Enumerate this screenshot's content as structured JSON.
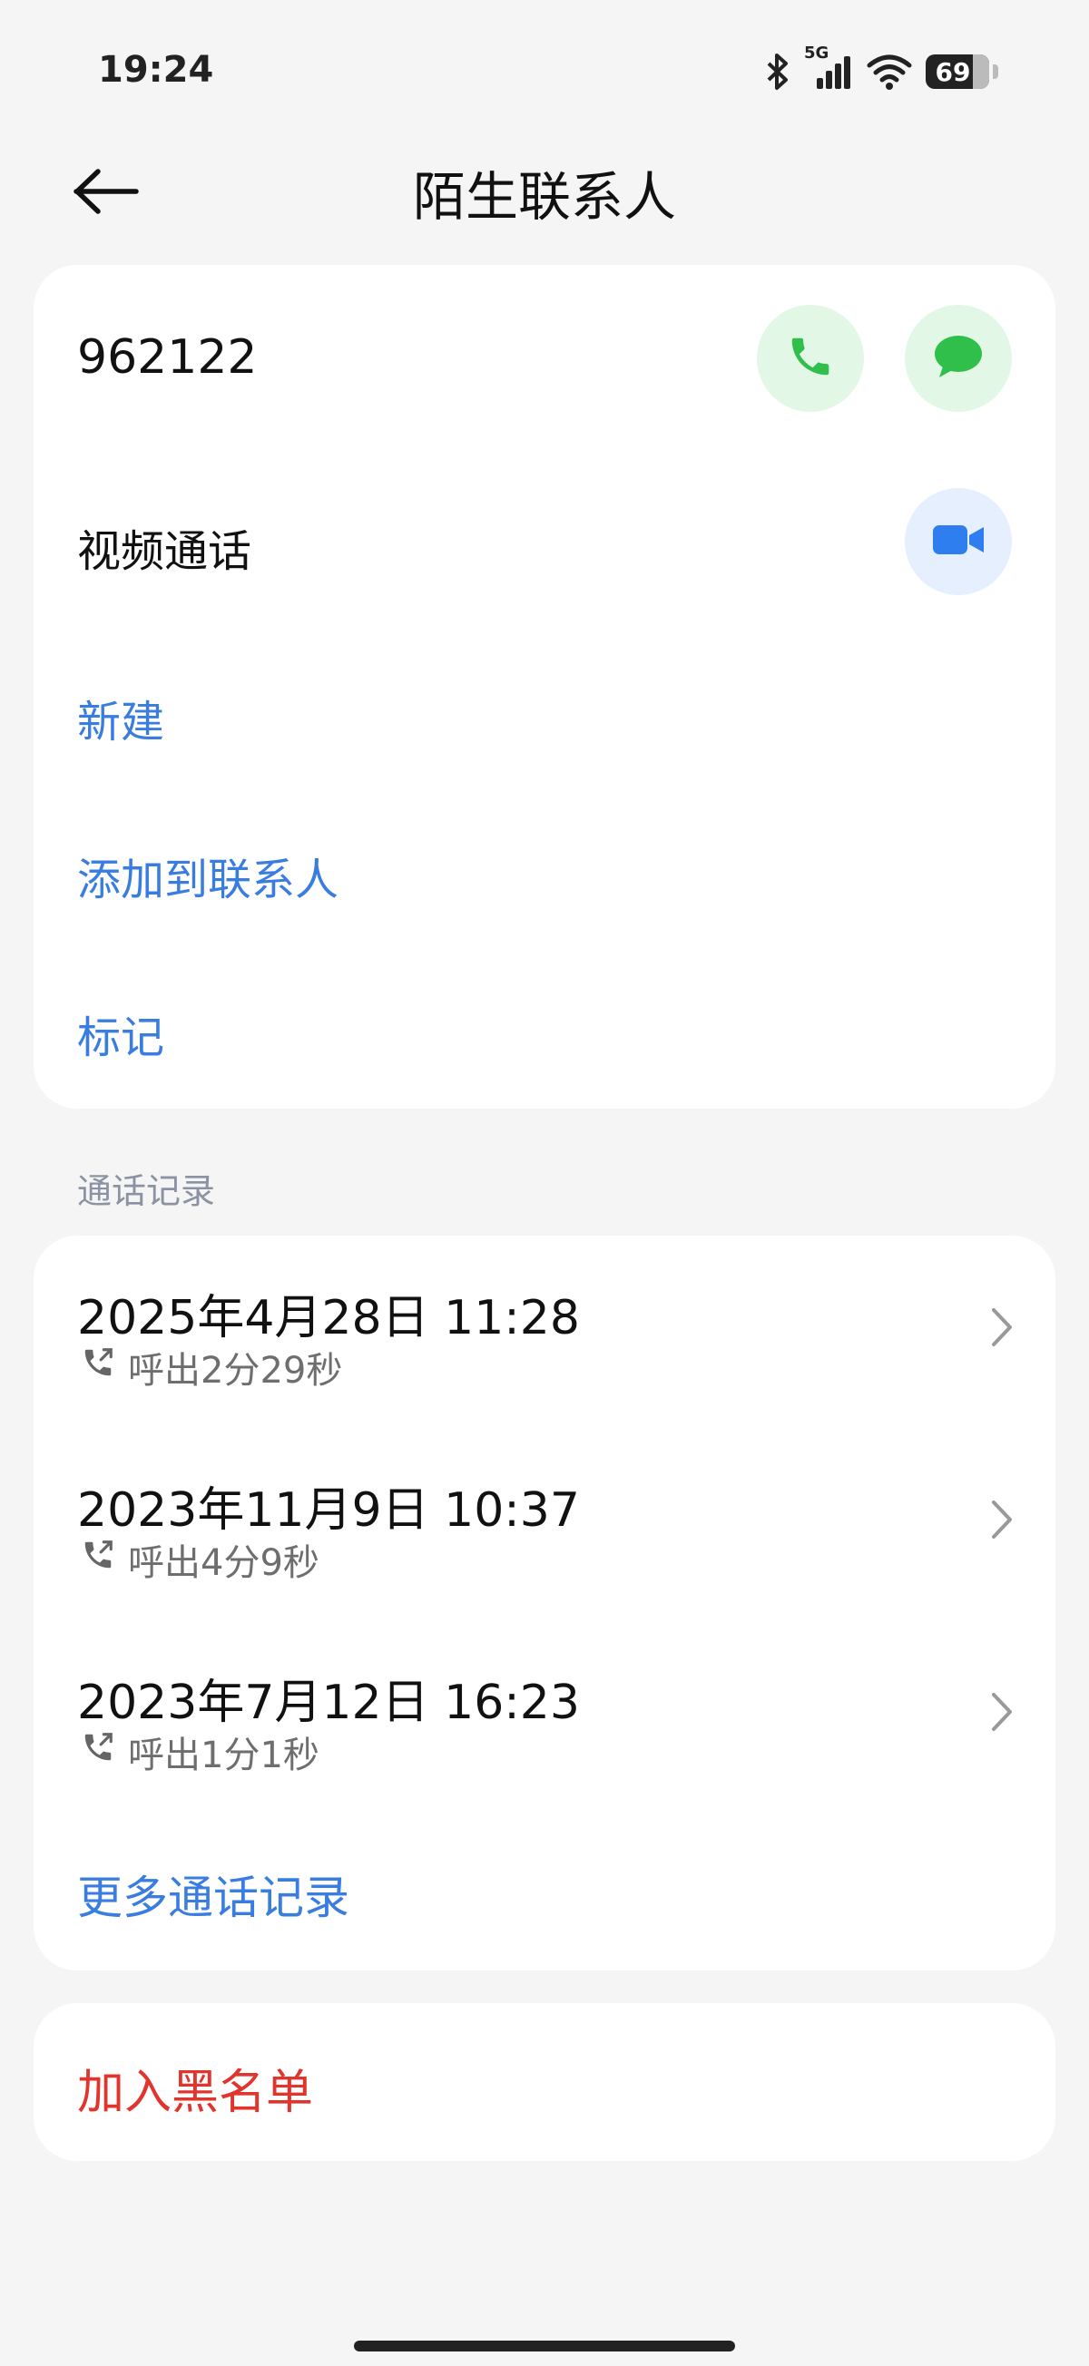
{
  "status_bar": {
    "time": "19:24",
    "battery": "69",
    "network": "5G"
  },
  "header": {
    "title": "陌生联系人"
  },
  "contact": {
    "number": "962122",
    "video_call_label": "视频通话",
    "new_label": "新建",
    "add_to_contacts_label": "添加到联系人",
    "mark_label": "标记"
  },
  "call_log": {
    "section_title": "通话记录",
    "items": [
      {
        "datetime": "2025年4月28日 11:28",
        "detail": "呼出2分29秒"
      },
      {
        "datetime": "2023年11月9日 10:37",
        "detail": "呼出4分9秒"
      },
      {
        "datetime": "2023年7月12日 16:23",
        "detail": "呼出1分1秒"
      }
    ],
    "more_label": "更多通话记录"
  },
  "block": {
    "label": "加入黑名单"
  },
  "colors": {
    "accent_blue": "#3a7de0",
    "call_green": "#2fbf4a",
    "danger_red": "#e0342c",
    "video_blue": "#2f7ef0"
  },
  "icons": {
    "back": "arrow-left-icon",
    "call": "phone-icon",
    "message": "chat-bubble-icon",
    "video": "video-camera-icon",
    "outgoing": "outgoing-call-icon",
    "chevron": "chevron-right-icon"
  }
}
